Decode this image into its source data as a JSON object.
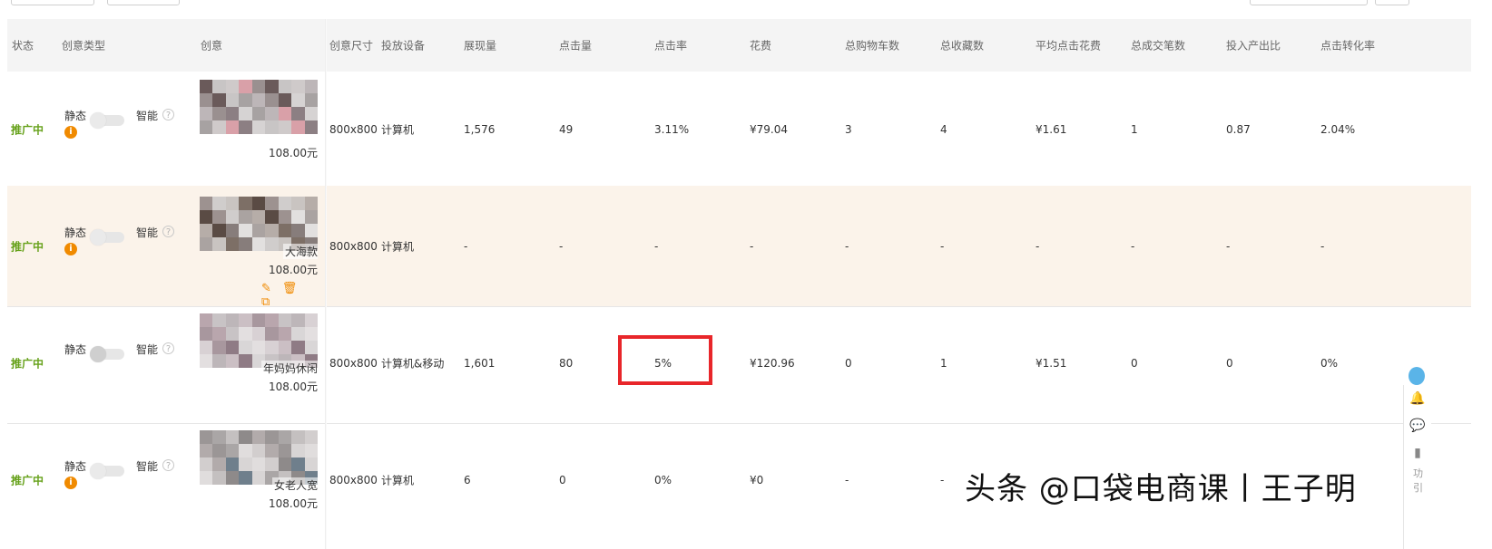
{
  "headers": {
    "status": "状态",
    "creative_type": "创意类型",
    "creative": "创意",
    "size": "创意尺寸",
    "device": "投放设备",
    "impressions": "展现量",
    "clicks": "点击量",
    "ctr": "点击率",
    "cost": "花费",
    "cart": "总购物车数",
    "fav": "总收藏数",
    "avg_cpc": "平均点击花费",
    "deals": "总成交笔数",
    "roi": "投入产出比",
    "cvr": "点击转化率"
  },
  "type_labels": {
    "static": "静态",
    "smart": "智能",
    "help": "?",
    "info": "i"
  },
  "rows": [
    {
      "status": "推广中",
      "title": "",
      "price": "108.00元",
      "size": "800x800",
      "device": "计算机",
      "impressions": "1,576",
      "clicks": "49",
      "ctr": "3.11%",
      "cost": "¥79.04",
      "cart": "3",
      "fav": "4",
      "avg_cpc": "¥1.61",
      "deals": "1",
      "roi": "0.87",
      "cvr": "2.04%"
    },
    {
      "status": "推广中",
      "title": "大海款",
      "price": "108.00元",
      "size": "800x800",
      "device": "计算机",
      "impressions": "-",
      "clicks": "-",
      "ctr": "-",
      "cost": "-",
      "cart": "-",
      "fav": "-",
      "avg_cpc": "-",
      "deals": "-",
      "roi": "-",
      "cvr": "-"
    },
    {
      "status": "推广中",
      "title": "年妈妈休闲",
      "price": "108.00元",
      "size": "800x800",
      "device": "计算机&移动",
      "impressions": "1,601",
      "clicks": "80",
      "ctr": "5%",
      "cost": "¥120.96",
      "cart": "0",
      "fav": "1",
      "avg_cpc": "¥1.51",
      "deals": "0",
      "roi": "0",
      "cvr": "0%"
    },
    {
      "status": "推广中",
      "title": "女老人宽",
      "price": "108.00元",
      "size": "800x800",
      "device": "计算机",
      "impressions": "6",
      "clicks": "0",
      "ctr": "0%",
      "cost": "¥0",
      "cart": "-",
      "fav": "-",
      "avg_cpc": "",
      "deals": "",
      "roi": "",
      "cvr": ""
    }
  ],
  "actions": {
    "edit": "✎",
    "delete": "🗑",
    "copy": "⧉"
  },
  "watermark": "头条 @口袋电商课丨王子明",
  "side_tools": {
    "bell": "🔔",
    "chat": "💬",
    "book": "▮",
    "text1": "功",
    "text2": "引"
  },
  "colors": {
    "status_green": "#66a11a",
    "highlight_red": "#e8262a",
    "row_highlight": "#fbf3ea",
    "icon_orange": "#f08a00"
  }
}
